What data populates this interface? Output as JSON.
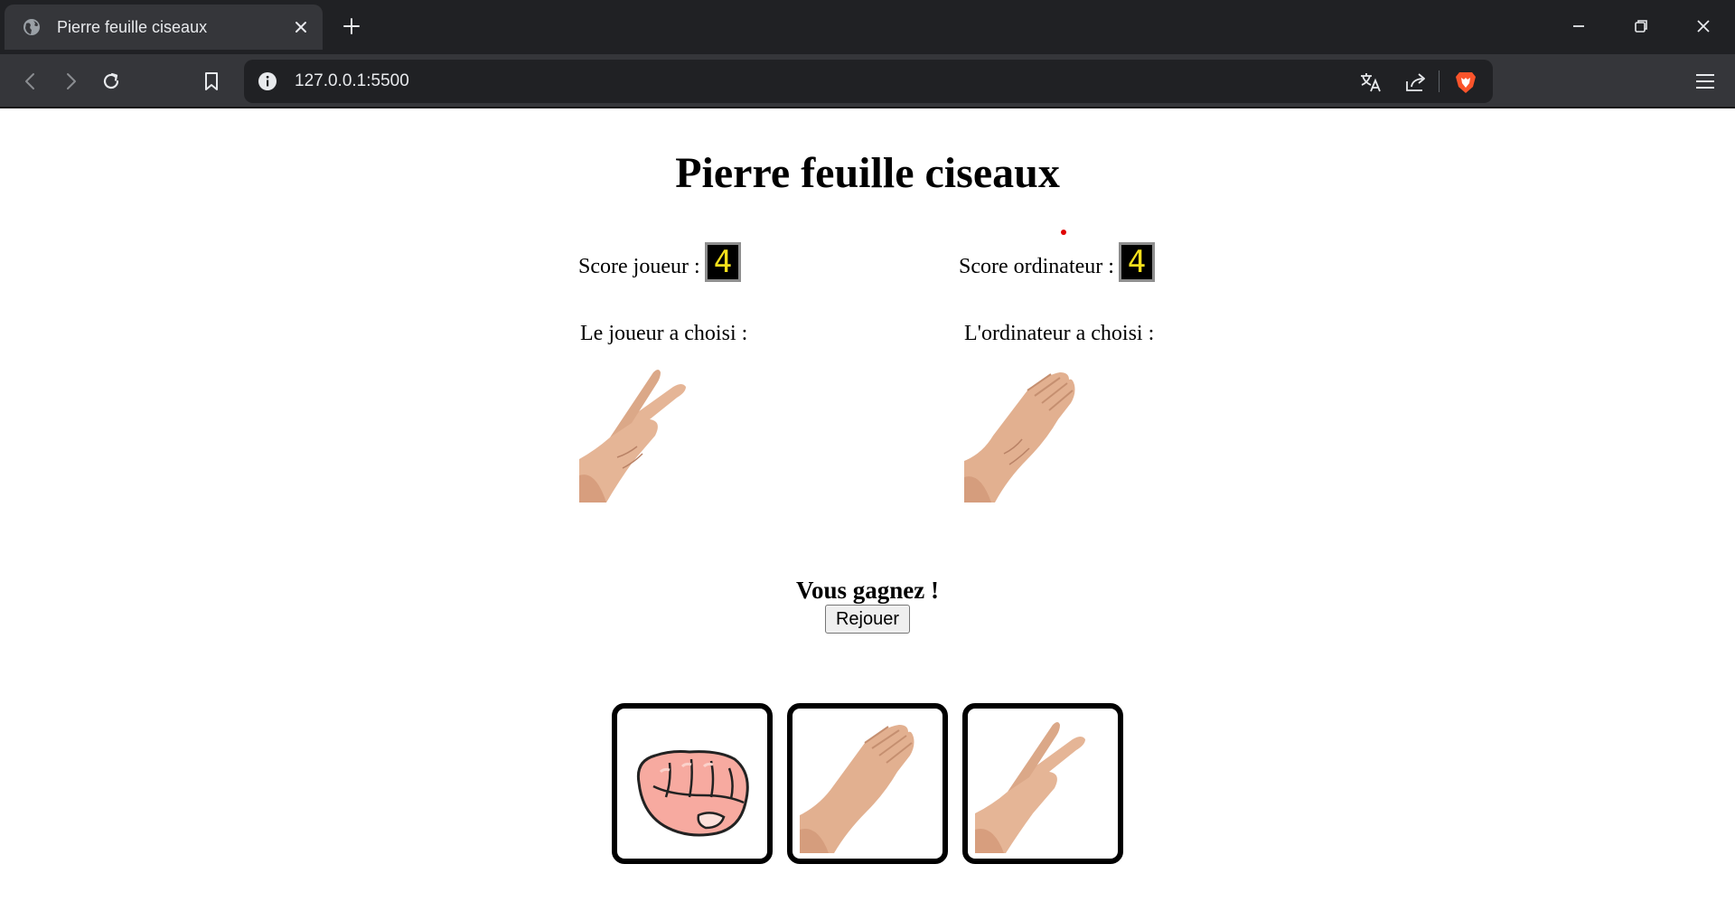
{
  "browser": {
    "tab_title": "Pierre feuille ciseaux",
    "url": "127.0.0.1:5500",
    "brand_color": "#fb542b"
  },
  "game": {
    "title": "Pierre feuille ciseaux",
    "player_score_label": "Score joueur :",
    "player_score": "4",
    "computer_score_label": "Score ordinateur :",
    "computer_score": "4",
    "player_choice_label": "Le joueur a choisi :",
    "player_choice": "scissors",
    "computer_choice_label": "L'ordinateur a choisi :",
    "computer_choice": "paper",
    "result": "Vous gagnez !",
    "replay_label": "Rejouer",
    "options": [
      "rock",
      "paper",
      "scissors"
    ]
  }
}
